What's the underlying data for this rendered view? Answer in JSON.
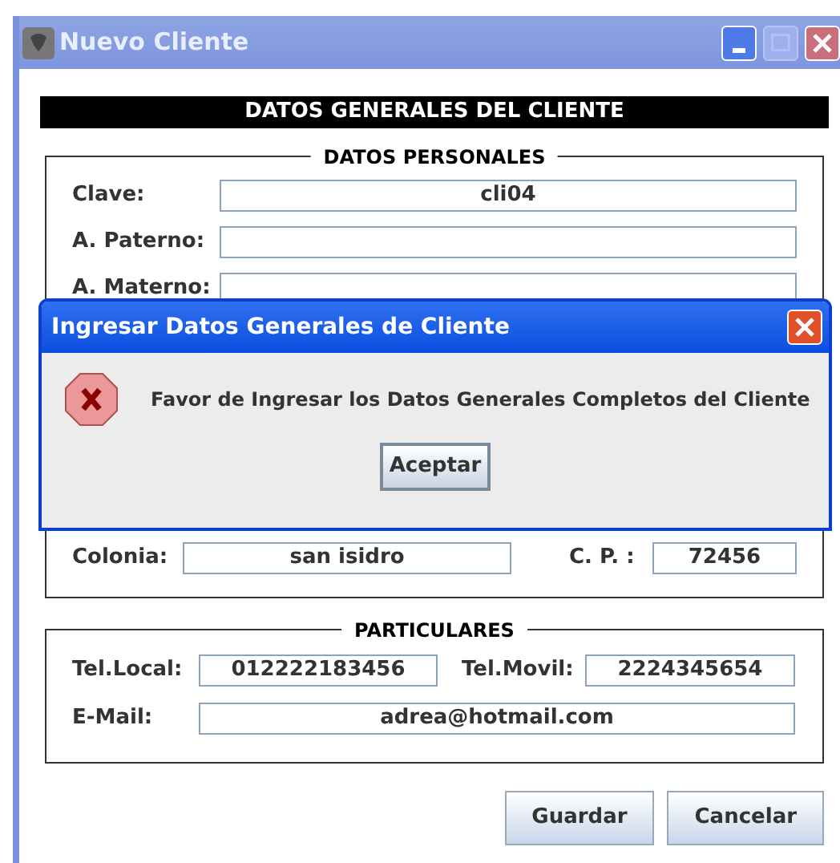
{
  "window": {
    "title": "Nuevo Cliente"
  },
  "header": "DATOS GENERALES DEL CLIENTE",
  "personales": {
    "legend": "DATOS PERSONALES",
    "fields": [
      {
        "label": "Clave:",
        "value": "cli04"
      },
      {
        "label": "A. Paterno:"
      },
      {
        "label": "A. Materno:"
      }
    ],
    "colonia": {
      "label": "Colonia:",
      "value": "san isidro"
    },
    "cp": {
      "label": "C. P. :",
      "value": "72456"
    }
  },
  "particulares": {
    "legend": "PARTICULARES",
    "tel_local": {
      "label": "Tel.Local:",
      "value": "012222183456"
    },
    "tel_movil": {
      "label": "Tel.Movil:",
      "value": "2224345654"
    },
    "email": {
      "label": "E-Mail:",
      "value": "adrea@hotmail.com"
    }
  },
  "buttons": [
    "Guardar",
    "Cancelar"
  ],
  "dialog": {
    "title": "Ingresar Datos Generales de Cliente",
    "message": "Favor de Ingresar los Datos Generales Completos del Cliente",
    "button": "Aceptar"
  }
}
